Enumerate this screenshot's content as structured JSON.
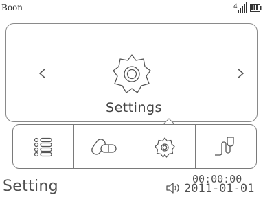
{
  "status_bar": {
    "app_name": "Boon",
    "signal_icon": "signal-bars-icon",
    "battery_icon": "battery-icon"
  },
  "carousel": {
    "left_icon": "chevron-left-icon",
    "right_icon": "chevron-right-icon",
    "current_item": {
      "icon": "gear-icon",
      "label": "Settings"
    }
  },
  "tabbar": {
    "tabs": [
      {
        "icon": "list-icon",
        "selected": false
      },
      {
        "icon": "pills-icon",
        "selected": false
      },
      {
        "icon": "gear-icon",
        "selected": true
      },
      {
        "icon": "tubing-infusion-icon",
        "selected": false
      }
    ]
  },
  "footer": {
    "mode_label": "Setting",
    "sound_icon": "speaker-icon",
    "time": "00:00:00",
    "date": "2011-01-01"
  },
  "colors": {
    "stroke": "#555555",
    "border": "#8a8a8a",
    "background": "#ffffff"
  }
}
